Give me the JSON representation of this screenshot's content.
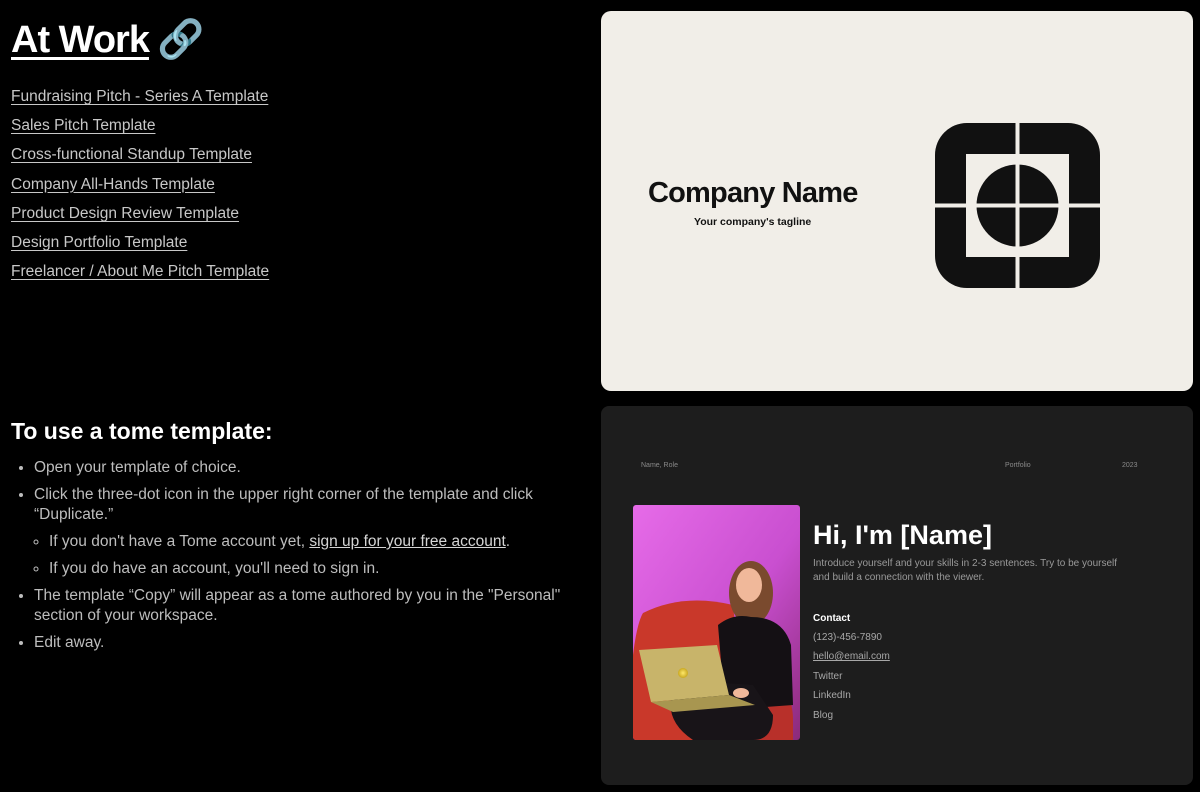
{
  "heading": {
    "title": "At Work",
    "emoji": "🔗"
  },
  "templates": [
    "Fundraising Pitch - Series A Template",
    "Sales Pitch Template",
    "Cross-functional Standup Template",
    "Company All-Hands Template",
    "Product Design Review Template",
    "Design Portfolio Template",
    "Freelancer / About Me Pitch Template"
  ],
  "howto": {
    "title": "To use a tome template:",
    "step1": "Open your template of choice.",
    "step2": "Click the three-dot icon in the upper right corner of the template and click “Duplicate.”",
    "sub1_prefix": "If you don't have a Tome account yet, ",
    "sub1_link": "sign up for your free account",
    "sub1_suffix": ".",
    "sub2": "If you do have an account, you'll need to sign in.",
    "step3": "The template “Copy” will appear as a tome authored by you in the \"Personal\" section of your workspace.",
    "step4": "Edit away."
  },
  "preview1": {
    "company_name": "Company Name",
    "tagline": "Your company's tagline",
    "logo_icon": "company-logo-icon",
    "bg": "#f1eee8"
  },
  "preview2": {
    "header_left": "Name, Role",
    "header_mid": "Portfolio",
    "header_right": "2023",
    "greeting": "Hi, I'm [Name]",
    "intro": "Introduce yourself and your skills in 2-3 sentences. Try to be yourself and build a connection with the viewer.",
    "contact_heading": "Contact",
    "phone": "(123)-456-7890",
    "email": "hello@email.com",
    "twitter": "Twitter",
    "linkedin": "LinkedIn",
    "blog": "Blog",
    "bg": "#1d1d1d"
  }
}
